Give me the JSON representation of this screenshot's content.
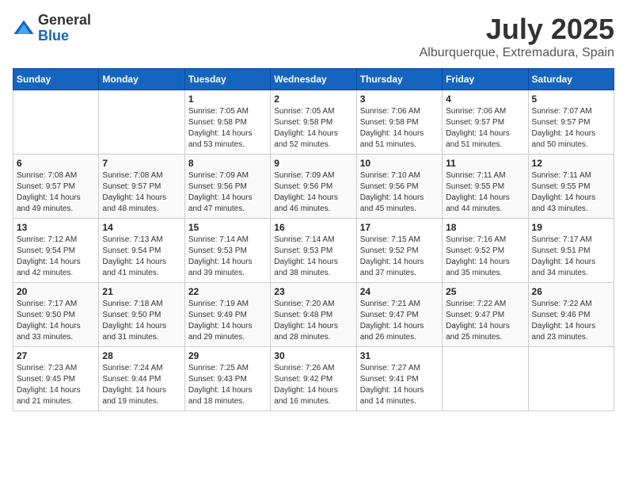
{
  "logo": {
    "general": "General",
    "blue": "Blue"
  },
  "title": "July 2025",
  "subtitle": "Alburquerque, Extremadura, Spain",
  "days_of_week": [
    "Sunday",
    "Monday",
    "Tuesday",
    "Wednesday",
    "Thursday",
    "Friday",
    "Saturday"
  ],
  "weeks": [
    [
      {
        "day": "",
        "sunrise": "",
        "sunset": "",
        "daylight": ""
      },
      {
        "day": "",
        "sunrise": "",
        "sunset": "",
        "daylight": ""
      },
      {
        "day": "1",
        "sunrise": "Sunrise: 7:05 AM",
        "sunset": "Sunset: 9:58 PM",
        "daylight": "Daylight: 14 hours and 53 minutes."
      },
      {
        "day": "2",
        "sunrise": "Sunrise: 7:05 AM",
        "sunset": "Sunset: 9:58 PM",
        "daylight": "Daylight: 14 hours and 52 minutes."
      },
      {
        "day": "3",
        "sunrise": "Sunrise: 7:06 AM",
        "sunset": "Sunset: 9:58 PM",
        "daylight": "Daylight: 14 hours and 51 minutes."
      },
      {
        "day": "4",
        "sunrise": "Sunrise: 7:06 AM",
        "sunset": "Sunset: 9:57 PM",
        "daylight": "Daylight: 14 hours and 51 minutes."
      },
      {
        "day": "5",
        "sunrise": "Sunrise: 7:07 AM",
        "sunset": "Sunset: 9:57 PM",
        "daylight": "Daylight: 14 hours and 50 minutes."
      }
    ],
    [
      {
        "day": "6",
        "sunrise": "Sunrise: 7:08 AM",
        "sunset": "Sunset: 9:57 PM",
        "daylight": "Daylight: 14 hours and 49 minutes."
      },
      {
        "day": "7",
        "sunrise": "Sunrise: 7:08 AM",
        "sunset": "Sunset: 9:57 PM",
        "daylight": "Daylight: 14 hours and 48 minutes."
      },
      {
        "day": "8",
        "sunrise": "Sunrise: 7:09 AM",
        "sunset": "Sunset: 9:56 PM",
        "daylight": "Daylight: 14 hours and 47 minutes."
      },
      {
        "day": "9",
        "sunrise": "Sunrise: 7:09 AM",
        "sunset": "Sunset: 9:56 PM",
        "daylight": "Daylight: 14 hours and 46 minutes."
      },
      {
        "day": "10",
        "sunrise": "Sunrise: 7:10 AM",
        "sunset": "Sunset: 9:56 PM",
        "daylight": "Daylight: 14 hours and 45 minutes."
      },
      {
        "day": "11",
        "sunrise": "Sunrise: 7:11 AM",
        "sunset": "Sunset: 9:55 PM",
        "daylight": "Daylight: 14 hours and 44 minutes."
      },
      {
        "day": "12",
        "sunrise": "Sunrise: 7:11 AM",
        "sunset": "Sunset: 9:55 PM",
        "daylight": "Daylight: 14 hours and 43 minutes."
      }
    ],
    [
      {
        "day": "13",
        "sunrise": "Sunrise: 7:12 AM",
        "sunset": "Sunset: 9:54 PM",
        "daylight": "Daylight: 14 hours and 42 minutes."
      },
      {
        "day": "14",
        "sunrise": "Sunrise: 7:13 AM",
        "sunset": "Sunset: 9:54 PM",
        "daylight": "Daylight: 14 hours and 41 minutes."
      },
      {
        "day": "15",
        "sunrise": "Sunrise: 7:14 AM",
        "sunset": "Sunset: 9:53 PM",
        "daylight": "Daylight: 14 hours and 39 minutes."
      },
      {
        "day": "16",
        "sunrise": "Sunrise: 7:14 AM",
        "sunset": "Sunset: 9:53 PM",
        "daylight": "Daylight: 14 hours and 38 minutes."
      },
      {
        "day": "17",
        "sunrise": "Sunrise: 7:15 AM",
        "sunset": "Sunset: 9:52 PM",
        "daylight": "Daylight: 14 hours and 37 minutes."
      },
      {
        "day": "18",
        "sunrise": "Sunrise: 7:16 AM",
        "sunset": "Sunset: 9:52 PM",
        "daylight": "Daylight: 14 hours and 35 minutes."
      },
      {
        "day": "19",
        "sunrise": "Sunrise: 7:17 AM",
        "sunset": "Sunset: 9:51 PM",
        "daylight": "Daylight: 14 hours and 34 minutes."
      }
    ],
    [
      {
        "day": "20",
        "sunrise": "Sunrise: 7:17 AM",
        "sunset": "Sunset: 9:50 PM",
        "daylight": "Daylight: 14 hours and 33 minutes."
      },
      {
        "day": "21",
        "sunrise": "Sunrise: 7:18 AM",
        "sunset": "Sunset: 9:50 PM",
        "daylight": "Daylight: 14 hours and 31 minutes."
      },
      {
        "day": "22",
        "sunrise": "Sunrise: 7:19 AM",
        "sunset": "Sunset: 9:49 PM",
        "daylight": "Daylight: 14 hours and 29 minutes."
      },
      {
        "day": "23",
        "sunrise": "Sunrise: 7:20 AM",
        "sunset": "Sunset: 9:48 PM",
        "daylight": "Daylight: 14 hours and 28 minutes."
      },
      {
        "day": "24",
        "sunrise": "Sunrise: 7:21 AM",
        "sunset": "Sunset: 9:47 PM",
        "daylight": "Daylight: 14 hours and 26 minutes."
      },
      {
        "day": "25",
        "sunrise": "Sunrise: 7:22 AM",
        "sunset": "Sunset: 9:47 PM",
        "daylight": "Daylight: 14 hours and 25 minutes."
      },
      {
        "day": "26",
        "sunrise": "Sunrise: 7:22 AM",
        "sunset": "Sunset: 9:46 PM",
        "daylight": "Daylight: 14 hours and 23 minutes."
      }
    ],
    [
      {
        "day": "27",
        "sunrise": "Sunrise: 7:23 AM",
        "sunset": "Sunset: 9:45 PM",
        "daylight": "Daylight: 14 hours and 21 minutes."
      },
      {
        "day": "28",
        "sunrise": "Sunrise: 7:24 AM",
        "sunset": "Sunset: 9:44 PM",
        "daylight": "Daylight: 14 hours and 19 minutes."
      },
      {
        "day": "29",
        "sunrise": "Sunrise: 7:25 AM",
        "sunset": "Sunset: 9:43 PM",
        "daylight": "Daylight: 14 hours and 18 minutes."
      },
      {
        "day": "30",
        "sunrise": "Sunrise: 7:26 AM",
        "sunset": "Sunset: 9:42 PM",
        "daylight": "Daylight: 14 hours and 16 minutes."
      },
      {
        "day": "31",
        "sunrise": "Sunrise: 7:27 AM",
        "sunset": "Sunset: 9:41 PM",
        "daylight": "Daylight: 14 hours and 14 minutes."
      },
      {
        "day": "",
        "sunrise": "",
        "sunset": "",
        "daylight": ""
      },
      {
        "day": "",
        "sunrise": "",
        "sunset": "",
        "daylight": ""
      }
    ]
  ]
}
